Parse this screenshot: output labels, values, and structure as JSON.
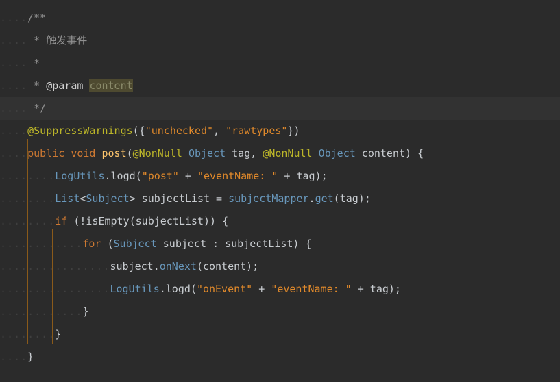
{
  "colors": {
    "background": "#2b2b2b",
    "current_line": "#323232",
    "comment": "#808080",
    "keyword": "#cc7832",
    "annotation": "#bbb529",
    "string": "#6a8759",
    "plain": "#a9b7c6",
    "type_ref": "#6897bb",
    "whitespace_dots": "#3f3f3f"
  },
  "code": {
    "lines": [
      {
        "ws": "....",
        "parts": [
          {
            "cls": "c-comment",
            "text": "/**"
          }
        ]
      },
      {
        "ws": "....",
        "parts": [
          {
            "cls": "c-comment",
            "text": " * 触发事件"
          }
        ]
      },
      {
        "ws": "....",
        "parts": [
          {
            "cls": "c-comment",
            "text": " *"
          }
        ]
      },
      {
        "ws": "....",
        "parts": [
          {
            "cls": "c-comment",
            "text": " * "
          },
          {
            "cls": "c-tag",
            "text": "@param"
          },
          {
            "cls": "c-comment",
            "text": " "
          },
          {
            "cls": "c-param",
            "text": "content"
          }
        ]
      },
      {
        "ws": "....",
        "parts": [
          {
            "cls": "c-comment",
            "text": " */"
          }
        ]
      },
      {
        "ws": "....",
        "parts": [
          {
            "cls": "c-anno",
            "text": "@SuppressWarnings"
          },
          {
            "cls": "c-plain",
            "text": "({"
          },
          {
            "cls": "c-str",
            "text": "\"unchecked\""
          },
          {
            "cls": "c-plain",
            "text": ", "
          },
          {
            "cls": "c-str",
            "text": "\"rawtypes\""
          },
          {
            "cls": "c-plain",
            "text": "})"
          }
        ]
      },
      {
        "ws": "....",
        "parts": [
          {
            "cls": "c-kw",
            "text": "public void "
          },
          {
            "cls": "c-fn",
            "text": "post"
          },
          {
            "cls": "c-plain",
            "text": "("
          },
          {
            "cls": "c-anno",
            "text": "@NonNull "
          },
          {
            "cls": "c-type",
            "text": "Object"
          },
          {
            "cls": "c-plain",
            "text": " tag, "
          },
          {
            "cls": "c-anno",
            "text": "@NonNull "
          },
          {
            "cls": "c-type",
            "text": "Object"
          },
          {
            "cls": "c-plain",
            "text": " content) {"
          }
        ]
      },
      {
        "ws": "........",
        "parts": [
          {
            "cls": "c-type",
            "text": "LogUtils"
          },
          {
            "cls": "c-plain",
            "text": ".logd("
          },
          {
            "cls": "c-str",
            "text": "\"post\""
          },
          {
            "cls": "c-plain",
            "text": " + "
          },
          {
            "cls": "c-str",
            "text": "\"eventName: \""
          },
          {
            "cls": "c-plain",
            "text": " + tag);"
          }
        ]
      },
      {
        "ws": "........",
        "parts": [
          {
            "cls": "c-type",
            "text": "List"
          },
          {
            "cls": "c-plain",
            "text": "<"
          },
          {
            "cls": "c-type",
            "text": "Subject"
          },
          {
            "cls": "c-plain",
            "text": "> subjectList = "
          },
          {
            "cls": "c-type",
            "text": "subjectMapper"
          },
          {
            "cls": "c-plain",
            "text": "."
          },
          {
            "cls": "c-type",
            "text": "get"
          },
          {
            "cls": "c-plain",
            "text": "(tag);"
          }
        ]
      },
      {
        "ws": "........",
        "parts": [
          {
            "cls": "c-kw",
            "text": "if"
          },
          {
            "cls": "c-plain",
            "text": " (!isEmpty(subjectList)) {"
          }
        ]
      },
      {
        "ws": "............",
        "parts": [
          {
            "cls": "c-kw",
            "text": "for"
          },
          {
            "cls": "c-plain",
            "text": " ("
          },
          {
            "cls": "c-type",
            "text": "Subject"
          },
          {
            "cls": "c-plain",
            "text": " subject : subjectList) {"
          }
        ]
      },
      {
        "ws": "................",
        "parts": [
          {
            "cls": "c-plain",
            "text": "subject."
          },
          {
            "cls": "c-type",
            "text": "onNext"
          },
          {
            "cls": "c-plain",
            "text": "(content);"
          }
        ]
      },
      {
        "ws": "................",
        "parts": [
          {
            "cls": "c-type",
            "text": "LogUtils"
          },
          {
            "cls": "c-plain",
            "text": ".logd("
          },
          {
            "cls": "c-str",
            "text": "\"onEvent\""
          },
          {
            "cls": "c-plain",
            "text": " + "
          },
          {
            "cls": "c-str",
            "text": "\"eventName: \""
          },
          {
            "cls": "c-plain",
            "text": " + tag);"
          }
        ]
      },
      {
        "ws": "............",
        "parts": [
          {
            "cls": "c-plain",
            "text": "}"
          }
        ]
      },
      {
        "ws": "........",
        "parts": [
          {
            "cls": "c-plain",
            "text": "}"
          }
        ]
      },
      {
        "ws": "....",
        "parts": [
          {
            "cls": "c-plain",
            "text": "}"
          }
        ]
      }
    ],
    "current_line_index": 4
  }
}
